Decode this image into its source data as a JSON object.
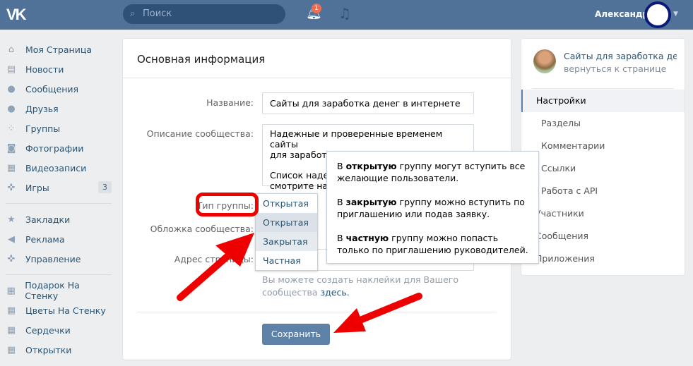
{
  "header": {
    "logo": "VK",
    "search_placeholder": "Поиск",
    "notifications_count": "1",
    "user_name": "Александр"
  },
  "sidebar": {
    "items": [
      {
        "label": "Моя Страница",
        "icon": "home-icon"
      },
      {
        "label": "Новости",
        "icon": "news-icon"
      },
      {
        "label": "Сообщения",
        "icon": "messages-icon"
      },
      {
        "label": "Друзья",
        "icon": "friends-icon"
      },
      {
        "label": "Группы",
        "icon": "groups-icon"
      },
      {
        "label": "Фотографии",
        "icon": "camera-icon"
      },
      {
        "label": "Видеозаписи",
        "icon": "video-icon"
      },
      {
        "label": "Игры",
        "icon": "gamepad-icon",
        "count": "3"
      }
    ],
    "items2": [
      {
        "label": "Закладки",
        "icon": "star-icon"
      },
      {
        "label": "Реклама",
        "icon": "megaphone-icon"
      },
      {
        "label": "Управление",
        "icon": "gamepad-icon"
      }
    ],
    "apps": [
      {
        "label": "Подарок На Стенку"
      },
      {
        "label": "Цветы На Стенку"
      },
      {
        "label": "Сердечки"
      },
      {
        "label": "Открытки"
      }
    ]
  },
  "main": {
    "title": "Основная информация",
    "name_label": "Название:",
    "name_value": "Сайты для заработка денег в интернете",
    "desc_label": "Описание сообщества:",
    "desc_line1": "Надежные и проверенные временем сайты",
    "desc_line2": "для заработка денег в интернете.",
    "desc_line3": "Список надеж",
    "desc_line4": "смотрите на с",
    "type_label": "Тип группы:",
    "type_selected": "Открытая",
    "type_options": [
      "Открытая",
      "Закрытая",
      "Частная"
    ],
    "cover_label": "Обложка сообщества:",
    "address_label": "Адрес страницы:",
    "address_value": "n/",
    "hint_text": "Вы можете создать наклейки для Вашего сообщества",
    "hint_link": "здесь.",
    "save_label": "Сохранить",
    "tooltip": {
      "p1_pre": "В ",
      "p1_bold": "открытую",
      "p1_post": " группу могут вступить все желающие пользователи.",
      "p2_pre": "В ",
      "p2_bold": "закрытую",
      "p2_post": " группу можно вступить по приглашению или подав заявку.",
      "p3_pre": "В ",
      "p3_bold": "частную",
      "p3_post": " группу можно попасть только по приглашению руководителей."
    }
  },
  "right": {
    "group_name": "Сайты для заработка де...",
    "back_link": "вернуться к странице",
    "menu": [
      "Настройки",
      "Разделы",
      "Комментарии",
      "Ссылки",
      "Работа с API",
      "Участники",
      "Сообщения",
      "Приложения"
    ]
  },
  "colors": {
    "header": "#507299",
    "accent": "#5e81a8",
    "annotation": "#ee0000"
  }
}
